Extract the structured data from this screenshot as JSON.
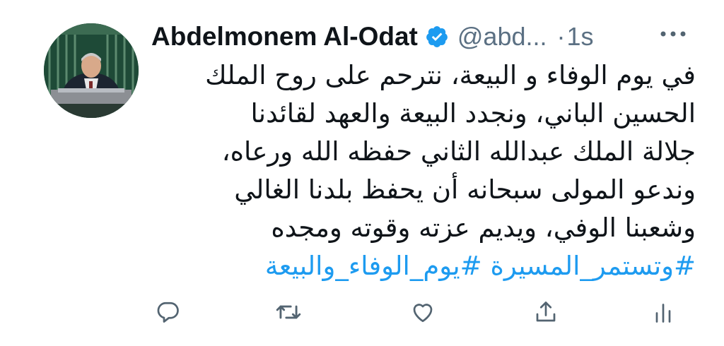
{
  "tweet": {
    "display_name": "Abdelmonem Al-Odat",
    "handle": "@abd...",
    "separator": "·",
    "timestamp": "1s",
    "verified": true,
    "body_lines": [
      "في يوم الوفاء و البيعة، نترحم على روح الملك",
      "الحسين الباني، ونجدد البيعة والعهد لقائدنا",
      "جلالة الملك عبدالله الثاني حفظه الله ورعاه،",
      "وندعو المولى سبحانه أن يحفظ بلدنا الغالي",
      "وشعبنا الوفي، ويديم عزته وقوته ومجده"
    ],
    "hashtags": [
      "#وتستمر_المسيرة",
      "#يوم_الوفاء_والبيعة"
    ]
  },
  "icons": {
    "more": "more-dots-icon",
    "verified": "verified-badge-icon",
    "reply": "reply-icon",
    "retweet": "retweet-icon",
    "like": "heart-icon",
    "share": "share-icon",
    "analytics": "analytics-icon"
  },
  "colors": {
    "accent": "#1d9bf0",
    "text": "#0f1419",
    "muted": "#5b7083",
    "icon": "#536471"
  }
}
